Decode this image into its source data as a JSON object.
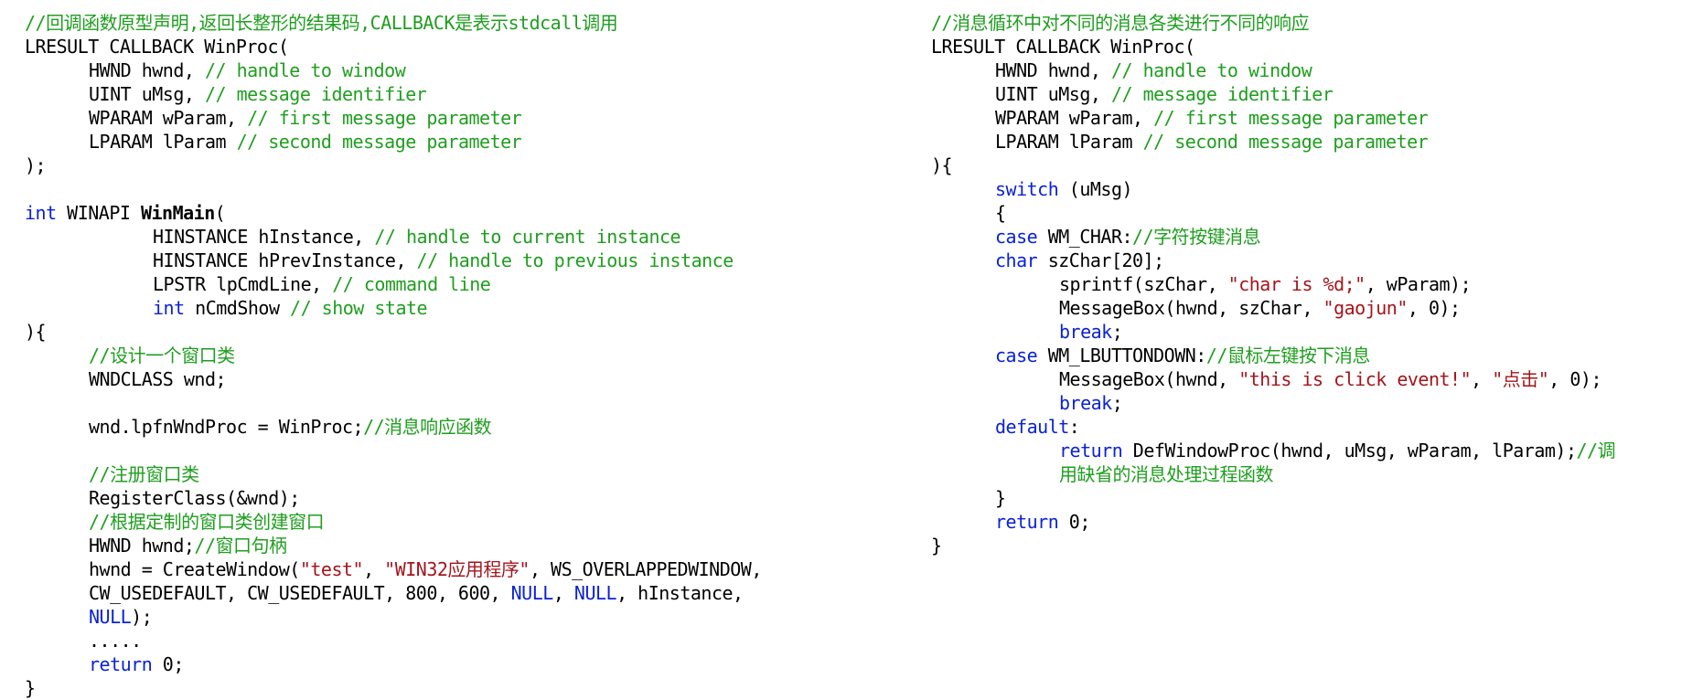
{
  "colors": {
    "comment": "#1f9e1f",
    "keyword": "#0a22d6",
    "string": "#a3151b",
    "text": "#000000"
  },
  "left_code": [
    {
      "indent": 0,
      "tokens": [
        {
          "t": "c",
          "v": "//回调函数原型声明,返回长整形的结果码,CALLBACK是表示stdcall调用"
        }
      ]
    },
    {
      "indent": 0,
      "tokens": [
        {
          "t": "n",
          "v": "LRESULT CALLBACK WinProc("
        }
      ]
    },
    {
      "indent": 1,
      "tokens": [
        {
          "t": "n",
          "v": "HWND hwnd, "
        },
        {
          "t": "c",
          "v": "// handle to window"
        }
      ]
    },
    {
      "indent": 1,
      "tokens": [
        {
          "t": "n",
          "v": "UINT uMsg, "
        },
        {
          "t": "c",
          "v": "// message identifier"
        }
      ]
    },
    {
      "indent": 1,
      "tokens": [
        {
          "t": "n",
          "v": "WPARAM wParam, "
        },
        {
          "t": "c",
          "v": "// first message parameter"
        }
      ]
    },
    {
      "indent": 1,
      "tokens": [
        {
          "t": "n",
          "v": "LPARAM lParam "
        },
        {
          "t": "c",
          "v": "// second message parameter"
        }
      ]
    },
    {
      "indent": 0,
      "tokens": [
        {
          "t": "n",
          "v": ");"
        }
      ]
    },
    {
      "indent": 0,
      "tokens": []
    },
    {
      "indent": 0,
      "tokens": [
        {
          "t": "k",
          "v": "int"
        },
        {
          "t": "n",
          "v": " WINAPI "
        },
        {
          "t": "f",
          "v": "WinMain"
        },
        {
          "t": "n",
          "v": "("
        }
      ]
    },
    {
      "indent": 2,
      "tokens": [
        {
          "t": "n",
          "v": "HINSTANCE hInstance, "
        },
        {
          "t": "c",
          "v": "// handle to current instance"
        }
      ]
    },
    {
      "indent": 2,
      "tokens": [
        {
          "t": "n",
          "v": "HINSTANCE hPrevInstance, "
        },
        {
          "t": "c",
          "v": "// handle to previous instance"
        }
      ]
    },
    {
      "indent": 2,
      "tokens": [
        {
          "t": "n",
          "v": "LPSTR lpCmdLine, "
        },
        {
          "t": "c",
          "v": "// command line"
        }
      ]
    },
    {
      "indent": 2,
      "tokens": [
        {
          "t": "k",
          "v": "int"
        },
        {
          "t": "n",
          "v": " nCmdShow "
        },
        {
          "t": "c",
          "v": "// show state"
        }
      ]
    },
    {
      "indent": 0,
      "tokens": [
        {
          "t": "n",
          "v": "){"
        }
      ]
    },
    {
      "indent": 1,
      "tokens": [
        {
          "t": "c",
          "v": "//设计一个窗口类"
        }
      ]
    },
    {
      "indent": 1,
      "tokens": [
        {
          "t": "n",
          "v": "WNDCLASS wnd;"
        }
      ]
    },
    {
      "indent": 0,
      "tokens": []
    },
    {
      "indent": 1,
      "tokens": [
        {
          "t": "n",
          "v": "wnd.lpfnWndProc = WinProc;"
        },
        {
          "t": "c",
          "v": "//消息响应函数"
        }
      ]
    },
    {
      "indent": 0,
      "tokens": []
    },
    {
      "indent": 1,
      "tokens": [
        {
          "t": "c",
          "v": "//注册窗口类"
        }
      ]
    },
    {
      "indent": 1,
      "tokens": [
        {
          "t": "n",
          "v": "RegisterClass(&wnd);"
        }
      ]
    },
    {
      "indent": 1,
      "tokens": [
        {
          "t": "c",
          "v": "//根据定制的窗口类创建窗口"
        }
      ]
    },
    {
      "indent": 1,
      "tokens": [
        {
          "t": "n",
          "v": "HWND hwnd;"
        },
        {
          "t": "c",
          "v": "//窗口句柄"
        }
      ]
    },
    {
      "indent": 1,
      "tokens": [
        {
          "t": "n",
          "v": "hwnd = CreateWindow("
        },
        {
          "t": "s",
          "v": "\"test\""
        },
        {
          "t": "n",
          "v": ", "
        },
        {
          "t": "s",
          "v": "\"WIN32应用程序\""
        },
        {
          "t": "n",
          "v": ", WS_OVERLAPPEDWINDOW,"
        }
      ]
    },
    {
      "indent": 1,
      "tokens": [
        {
          "t": "n",
          "v": "CW_USEDEFAULT, CW_USEDEFAULT, 800, 600, "
        },
        {
          "t": "k",
          "v": "NULL"
        },
        {
          "t": "n",
          "v": ", "
        },
        {
          "t": "k",
          "v": "NULL"
        },
        {
          "t": "n",
          "v": ", hInstance,"
        }
      ]
    },
    {
      "indent": 1,
      "tokens": [
        {
          "t": "k",
          "v": "NULL"
        },
        {
          "t": "n",
          "v": ");"
        }
      ]
    },
    {
      "indent": 1,
      "tokens": [
        {
          "t": "n",
          "v": "....."
        }
      ]
    },
    {
      "indent": 1,
      "tokens": [
        {
          "t": "k",
          "v": "return"
        },
        {
          "t": "n",
          "v": " 0;"
        }
      ]
    },
    {
      "indent": 0,
      "tokens": [
        {
          "t": "n",
          "v": "}"
        }
      ]
    }
  ],
  "right_code": [
    {
      "indent": 0,
      "tokens": [
        {
          "t": "c",
          "v": "//消息循环中对不同的消息各类进行不同的响应"
        }
      ]
    },
    {
      "indent": 0,
      "tokens": [
        {
          "t": "n",
          "v": "LRESULT CALLBACK WinProc("
        }
      ]
    },
    {
      "indent": 1,
      "tokens": [
        {
          "t": "n",
          "v": "HWND hwnd, "
        },
        {
          "t": "c",
          "v": "// handle to window"
        }
      ]
    },
    {
      "indent": 1,
      "tokens": [
        {
          "t": "n",
          "v": "UINT uMsg, "
        },
        {
          "t": "c",
          "v": "// message identifier"
        }
      ]
    },
    {
      "indent": 1,
      "tokens": [
        {
          "t": "n",
          "v": "WPARAM wParam, "
        },
        {
          "t": "c",
          "v": "// first message parameter"
        }
      ]
    },
    {
      "indent": 1,
      "tokens": [
        {
          "t": "n",
          "v": "LPARAM lParam "
        },
        {
          "t": "c",
          "v": "// second message parameter"
        }
      ]
    },
    {
      "indent": 0,
      "tokens": [
        {
          "t": "n",
          "v": "){"
        }
      ]
    },
    {
      "indent": 1,
      "tokens": [
        {
          "t": "k",
          "v": "switch"
        },
        {
          "t": "n",
          "v": " (uMsg)"
        }
      ]
    },
    {
      "indent": 1,
      "tokens": [
        {
          "t": "n",
          "v": "{"
        }
      ]
    },
    {
      "indent": 1,
      "tokens": [
        {
          "t": "k",
          "v": "case"
        },
        {
          "t": "n",
          "v": " WM_CHAR:"
        },
        {
          "t": "c",
          "v": "//字符按键消息"
        }
      ]
    },
    {
      "indent": 1,
      "tokens": [
        {
          "t": "k",
          "v": "char"
        },
        {
          "t": "n",
          "v": " szChar[20];"
        }
      ]
    },
    {
      "indent": 2,
      "tokens": [
        {
          "t": "n",
          "v": "sprintf(szChar, "
        },
        {
          "t": "s",
          "v": "\"char is %d;\""
        },
        {
          "t": "n",
          "v": ", wParam);"
        }
      ]
    },
    {
      "indent": 2,
      "tokens": [
        {
          "t": "n",
          "v": "MessageBox(hwnd, szChar, "
        },
        {
          "t": "s",
          "v": "\"gaojun\""
        },
        {
          "t": "n",
          "v": ", 0);"
        }
      ]
    },
    {
      "indent": 2,
      "tokens": [
        {
          "t": "k",
          "v": "break"
        },
        {
          "t": "n",
          "v": ";"
        }
      ]
    },
    {
      "indent": 1,
      "tokens": [
        {
          "t": "k",
          "v": "case"
        },
        {
          "t": "n",
          "v": " WM_LBUTTONDOWN:"
        },
        {
          "t": "c",
          "v": "//鼠标左键按下消息"
        }
      ]
    },
    {
      "indent": 2,
      "tokens": [
        {
          "t": "n",
          "v": "MessageBox(hwnd, "
        },
        {
          "t": "s",
          "v": "\"this is click event!\""
        },
        {
          "t": "n",
          "v": ", "
        },
        {
          "t": "s",
          "v": "\"点击\""
        },
        {
          "t": "n",
          "v": ", 0);"
        }
      ]
    },
    {
      "indent": 2,
      "tokens": [
        {
          "t": "k",
          "v": "break"
        },
        {
          "t": "n",
          "v": ";"
        }
      ]
    },
    {
      "indent": 1,
      "tokens": [
        {
          "t": "k",
          "v": "default"
        },
        {
          "t": "n",
          "v": ":"
        }
      ]
    },
    {
      "indent": 2,
      "tokens": [
        {
          "t": "k",
          "v": "return"
        },
        {
          "t": "n",
          "v": " DefWindowProc(hwnd, uMsg, wParam, lParam);"
        },
        {
          "t": "c",
          "v": "//调"
        }
      ]
    },
    {
      "indent": 2,
      "tokens": [
        {
          "t": "c",
          "v": "用缺省的消息处理过程函数"
        }
      ]
    },
    {
      "indent": 1,
      "tokens": [
        {
          "t": "n",
          "v": "}"
        }
      ]
    },
    {
      "indent": 1,
      "tokens": [
        {
          "t": "k",
          "v": "return"
        },
        {
          "t": "n",
          "v": " 0;"
        }
      ]
    },
    {
      "indent": 0,
      "tokens": [
        {
          "t": "n",
          "v": "}"
        }
      ]
    }
  ]
}
